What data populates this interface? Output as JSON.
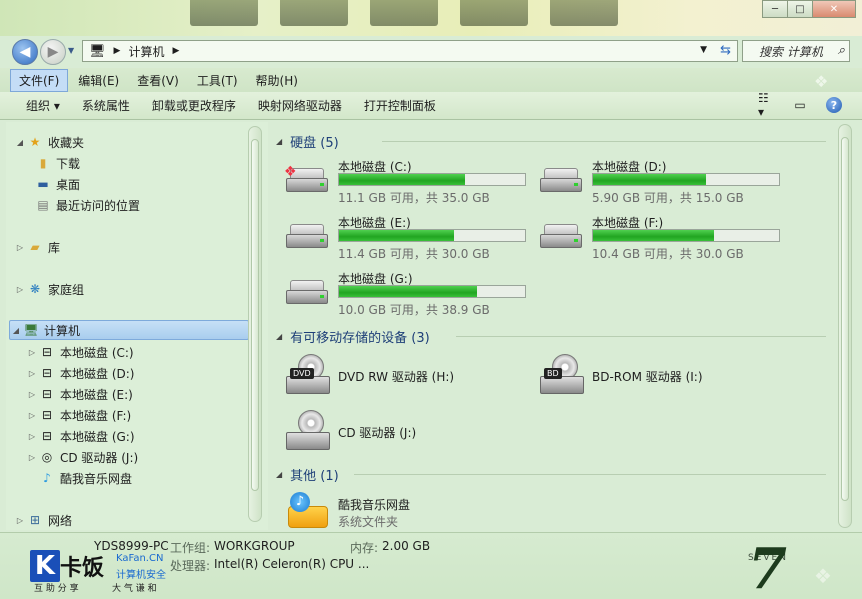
{
  "window": {
    "caption_buttons": [
      "minimize-icon",
      "maximize-icon",
      "close-icon"
    ]
  },
  "address_bar": {
    "crumbs": [
      "计算机"
    ],
    "search_placeholder": "搜索 计算机"
  },
  "menu": {
    "items": [
      "文件(F)",
      "编辑(E)",
      "查看(V)",
      "工具(T)",
      "帮助(H)"
    ]
  },
  "toolbar": {
    "commands": [
      "组织 ▾",
      "系统属性",
      "卸载或更改程序",
      "映射网络驱动器",
      "打开控制面板"
    ]
  },
  "sidebar": {
    "favorites": {
      "label": "收藏夹",
      "items": [
        "下载",
        "桌面",
        "最近访问的位置"
      ]
    },
    "library": "库",
    "homegroup": "家庭组",
    "computer": {
      "label": "计算机",
      "items": [
        "本地磁盘 (C:)",
        "本地磁盘 (D:)",
        "本地磁盘 (E:)",
        "本地磁盘 (F:)",
        "本地磁盘 (G:)",
        "CD 驱动器 (J:)",
        "酷我音乐网盘"
      ]
    },
    "network": "网络"
  },
  "groups": {
    "hard_disks": "硬盘 (5)",
    "removable": "有可移动存储的设备 (3)",
    "other": "其他 (1)"
  },
  "drives": [
    {
      "name": "本地磁盘 (C:)",
      "free": "11.1 GB 可用，共 35.0 GB",
      "used_fraction": 0.68
    },
    {
      "name": "本地磁盘 (D:)",
      "free": "5.90 GB 可用，共 15.0 GB",
      "used_fraction": 0.61
    },
    {
      "name": "本地磁盘 (E:)",
      "free": "11.4 GB 可用，共 30.0 GB",
      "used_fraction": 0.62
    },
    {
      "name": "本地磁盘 (F:)",
      "free": "10.4 GB 可用，共 30.0 GB",
      "used_fraction": 0.65
    },
    {
      "name": "本地磁盘 (G:)",
      "free": "10.0 GB 可用，共 38.9 GB",
      "used_fraction": 0.74
    }
  ],
  "devices": [
    {
      "name": "DVD RW 驱动器 (H:)",
      "badge": "DVD"
    },
    {
      "name": "BD-ROM 驱动器 (I:)",
      "badge": "BD"
    },
    {
      "name": "CD 驱动器 (J:)",
      "badge": ""
    }
  ],
  "other_items": [
    {
      "name": "酷我音乐网盘",
      "type": "系统文件夹"
    }
  ],
  "details": {
    "computer_name": "YDS8999-PC",
    "workgroup_label": "工作组:",
    "workgroup": "WORKGROUP",
    "memory_label": "内存:",
    "memory": "2.00 GB",
    "processor_label": "处理器:",
    "processor": "Intel(R) Celeron(R) CPU ..."
  },
  "watermark": {
    "brand": "卡饭",
    "site": "KaFan.CN",
    "tagline1": "计算机安全",
    "tagline2": "互 助 分 享",
    "tagline3": "大 气 谦 和",
    "seven_text": "SEVEN"
  },
  "colors": {
    "progress_fill": "#21a521",
    "group_header": "#1e3f78",
    "selection": "#a9cdee"
  }
}
